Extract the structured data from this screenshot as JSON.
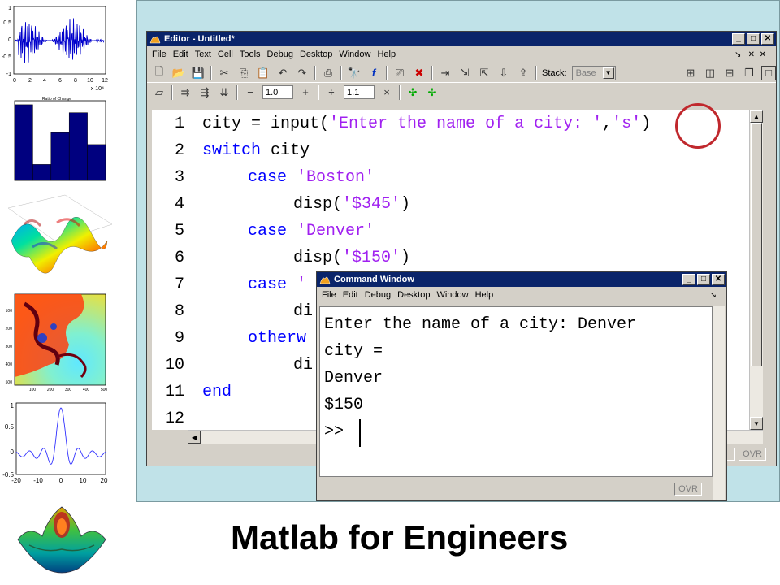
{
  "slide_title": "Matlab for Engineers",
  "thumbnails": {
    "waveform": {
      "y_ticks": [
        "1",
        "0.5",
        "0",
        "-0.5",
        "-1"
      ],
      "x_ticks": [
        "0",
        "2",
        "4",
        "6",
        "8",
        "10",
        "12"
      ],
      "x_scale": "x 10⁴"
    },
    "bar": {
      "title": "Ratio of Change",
      "values": [
        0.95,
        0.2,
        0.6,
        0.85,
        0.45
      ]
    },
    "fractal": {
      "y_ticks": [
        "100",
        "200",
        "300",
        "400",
        "500"
      ],
      "x_ticks": [
        "100",
        "200",
        "300",
        "400",
        "500"
      ]
    },
    "sinc": {
      "y_ticks": [
        "1",
        "0.5",
        "0",
        "-0.5"
      ],
      "x_ticks": [
        "-20",
        "-10",
        "0",
        "10",
        "20"
      ]
    }
  },
  "editor": {
    "title": "Editor - Untitled*",
    "menus": [
      "File",
      "Edit",
      "Text",
      "Cell",
      "Tools",
      "Debug",
      "Desktop",
      "Window",
      "Help"
    ],
    "stack_label": "Stack:",
    "stack_value": "Base",
    "cell_field_1": "1.0",
    "cell_field_2": "1.1",
    "line_numbers": [
      "1",
      "2",
      "3",
      "4",
      "5",
      "6",
      "7",
      "8",
      "9",
      "10",
      "11",
      "12"
    ],
    "code": {
      "l1": {
        "a": "city = input(",
        "s1": "'Enter the name of a city: '",
        "comma": ",",
        "s2": "'s'",
        "end": ")"
      },
      "l2": {
        "kw": "switch",
        "rest": " city"
      },
      "l3": {
        "kw": "case",
        "str": "'Boston'"
      },
      "l4": {
        "a": "disp(",
        "str": "'$345'",
        "end": ")"
      },
      "l5": {
        "kw": "case",
        "str": "'Denver'"
      },
      "l6": {
        "a": "disp(",
        "str": "'$150'",
        "end": ")"
      },
      "l7": {
        "kw": "case",
        "str": "'"
      },
      "l8": {
        "a": "di"
      },
      "l9": {
        "kw": "otherw"
      },
      "l10": {
        "a": "di"
      },
      "l11": {
        "kw": "end"
      }
    },
    "status_ovr": "OVR"
  },
  "command_window": {
    "title": "Command Window",
    "menus": [
      "File",
      "Edit",
      "Debug",
      "Desktop",
      "Window",
      "Help"
    ],
    "lines": [
      "Enter the name of a city: Denver",
      "city =",
      "Denver",
      "$150",
      ">>"
    ],
    "status_ovr": "OVR"
  },
  "colors": {
    "keyword": "#0000ff",
    "string": "#a020f0",
    "titlebar": "#0a246a",
    "annotation": "#c0282d"
  }
}
